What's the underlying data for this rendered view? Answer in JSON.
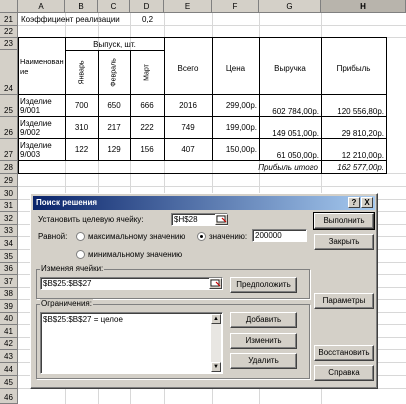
{
  "columns": [
    "A",
    "B",
    "C",
    "D",
    "E",
    "F",
    "G",
    "H"
  ],
  "selected_column": "H",
  "rows": [
    "21",
    "22",
    "23",
    "24",
    "25",
    "26",
    "27",
    "28",
    "29",
    "30",
    "31",
    "32",
    "33",
    "34",
    "35",
    "36",
    "37",
    "38",
    "39",
    "40",
    "41",
    "42",
    "43",
    "44",
    "45",
    "46"
  ],
  "sheet": {
    "r21_label": "Коэффициент реализации",
    "r21_value": "0,2",
    "header_output": "Выпуск, шт.",
    "header_name": "Наименование",
    "header_jan": "Январь",
    "header_feb": "Февраль",
    "header_mar": "Март",
    "header_total": "Всего",
    "header_price": "Цена",
    "header_revenue": "Выручка",
    "header_profit": "Прибыль",
    "items": [
      {
        "name": "Изделие 9/001",
        "jan": "700",
        "feb": "650",
        "mar": "666",
        "total": "2016",
        "price": "299,00р.",
        "revenue": "602 784,00р.",
        "profit": "120 556,80р."
      },
      {
        "name": "Изделие 9/002",
        "jan": "310",
        "feb": "217",
        "mar": "222",
        "total": "749",
        "price": "199,00р.",
        "revenue": "149 051,00р.",
        "profit": "29 810,20р."
      },
      {
        "name": "Изделие 9/003",
        "jan": "122",
        "feb": "129",
        "mar": "156",
        "total": "407",
        "price": "150,00р.",
        "revenue": "61 050,00р.",
        "profit": "12 210,00р."
      }
    ],
    "profit_total_label": "Прибыль итого",
    "profit_total_value": "162 577,00р."
  },
  "dialog": {
    "title": "Поиск решения",
    "help_btn": "?",
    "close_btn": "X",
    "target_label": "Установить целевую ячейку:",
    "target_value": "$H$28",
    "equal_label": "Равной:",
    "opt_max": "максимальному значению",
    "opt_value": "значению:",
    "opt_value_input": "200000",
    "opt_min": "минимальному значению",
    "changing_label": "Изменяя ячейки:",
    "changing_value": "$B$25:$B$27",
    "constraints_label": "Ограничения:",
    "constraints": [
      "$B$25:$B$27 = целое"
    ],
    "btn_run": "Выполнить",
    "btn_close": "Закрыть",
    "btn_guess": "Предположить",
    "btn_params": "Параметры",
    "btn_add": "Добавить",
    "btn_change": "Изменить",
    "btn_delete": "Удалить",
    "btn_restore": "Восстановить",
    "btn_help": "Справка",
    "selected_option": "value"
  }
}
